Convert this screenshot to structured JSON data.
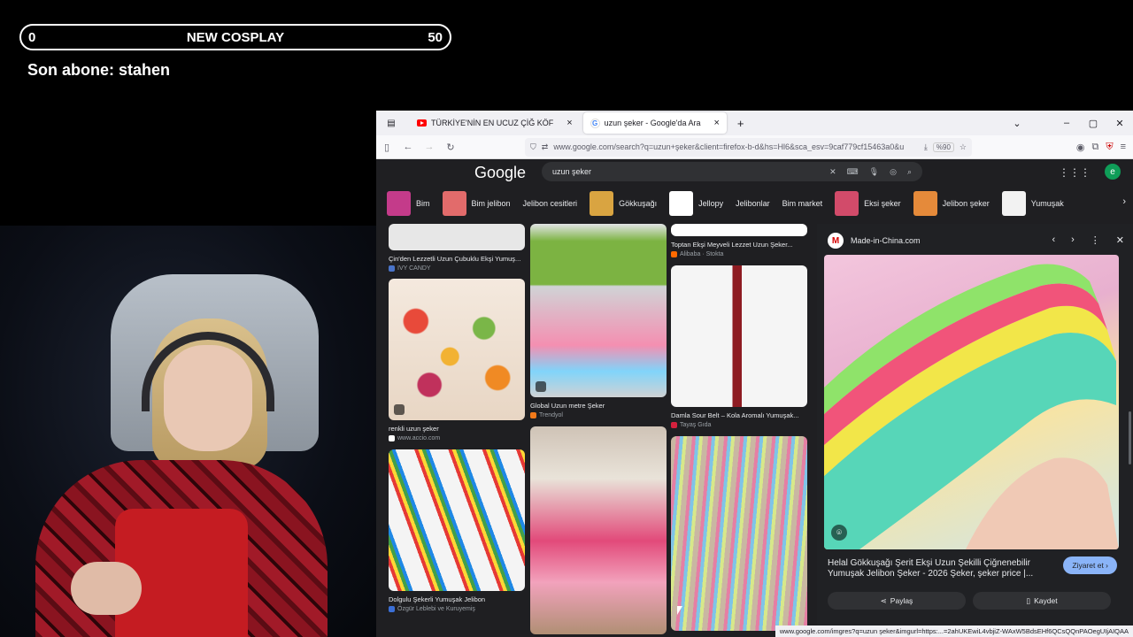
{
  "overlay": {
    "goal_min": "0",
    "goal_title": "NEW COSPLAY",
    "goal_max": "50",
    "last_sub": "Son abone: stahen"
  },
  "browser": {
    "tabs": [
      {
        "label": "TÜRKİYE'NİN EN UCUZ ÇİĞ KÖF",
        "icon": "youtube-icon",
        "active": false
      },
      {
        "label": "uzun şeker - Google'da Ara",
        "icon": "google-icon",
        "active": true
      }
    ],
    "url": "www.google.com/search?q=uzun+şeker&client=firefox-b-d&hs=Hl6&sca_esv=9caf779cf15463a0&u",
    "zoom": "%90",
    "status_url": "www.google.com/imgres?q=uzun şeker&imgurl=https:...=2ahUKEwiL4vbjiZ-WAxW5BdsEHf6QCsQQnPAOegUIjAIQAA"
  },
  "google": {
    "logo": "Google",
    "query": "uzun şeker",
    "chips": [
      {
        "label": "Bim",
        "color": "#c43b8a"
      },
      {
        "label": "Bim jelibon",
        "color": "#e26b6b"
      },
      {
        "label": "Jelibon cesitleri",
        "color": ""
      },
      {
        "label": "Gökkuşağı",
        "color": "#d9a441"
      },
      {
        "label": "Jellopy",
        "color": "#ffffff"
      },
      {
        "label": "Jelibonlar",
        "color": ""
      },
      {
        "label": "Bim market",
        "color": ""
      },
      {
        "label": "Eksi şeker",
        "color": "#d24b6a"
      },
      {
        "label": "Jelibon şeker",
        "color": "#e58a3a"
      },
      {
        "label": "Yumuşak",
        "color": "#f2f2f2"
      }
    ],
    "results": [
      {
        "title": "Çin'den Lezzetli Uzun Çubuklu Ekşi Yumuş...",
        "source": "IVY CANDY",
        "color": "#e7e7e7",
        "src_color": "#4a74c9"
      },
      {
        "title": "renkli uzun şeker",
        "source": "www.accio.com",
        "color": "#d85b3a",
        "src_color": "#ffffff"
      },
      {
        "title": "Dolgulu Şekerli Yumuşak Jelibon",
        "source": "Özgür Leblebi ve Kuruyemiş",
        "color": "#f4f4f4",
        "src_color": "#3b6fd6"
      },
      {
        "title": "Global Uzun metre Şeker",
        "source": "Trendyol",
        "color": "#cfd2d4",
        "src_color": "#f27a1a"
      },
      {
        "title": "",
        "source": "",
        "color": "#c9b9aa",
        "src_color": ""
      },
      {
        "title": "Toptan Ekşi Meyveli Lezzet Uzun Şeker...",
        "source": "Alibaba · Stokta",
        "color": "#ffffff",
        "src_color": "#ff6a00"
      },
      {
        "title": "Damla Sour Belt – Kola Aromalı Yumuşak...",
        "source": "Tayaş Gıda",
        "color": "#f5f5f5",
        "src_color": "#d4213d"
      },
      {
        "title": "",
        "source": "",
        "color": "#b7a58f",
        "src_color": ""
      }
    ],
    "preview": {
      "site": "Made-in-China.com",
      "title": "Helal Gökkuşağı Şerit Ekşi Uzun Şekilli Çiğnenebilir Yumuşak Jelibon Şeker - 2026 Şeker, şeker price |...",
      "visit_label": "Ziyaret et ›",
      "share_label": "Paylaş",
      "save_label": "Kaydet"
    }
  }
}
